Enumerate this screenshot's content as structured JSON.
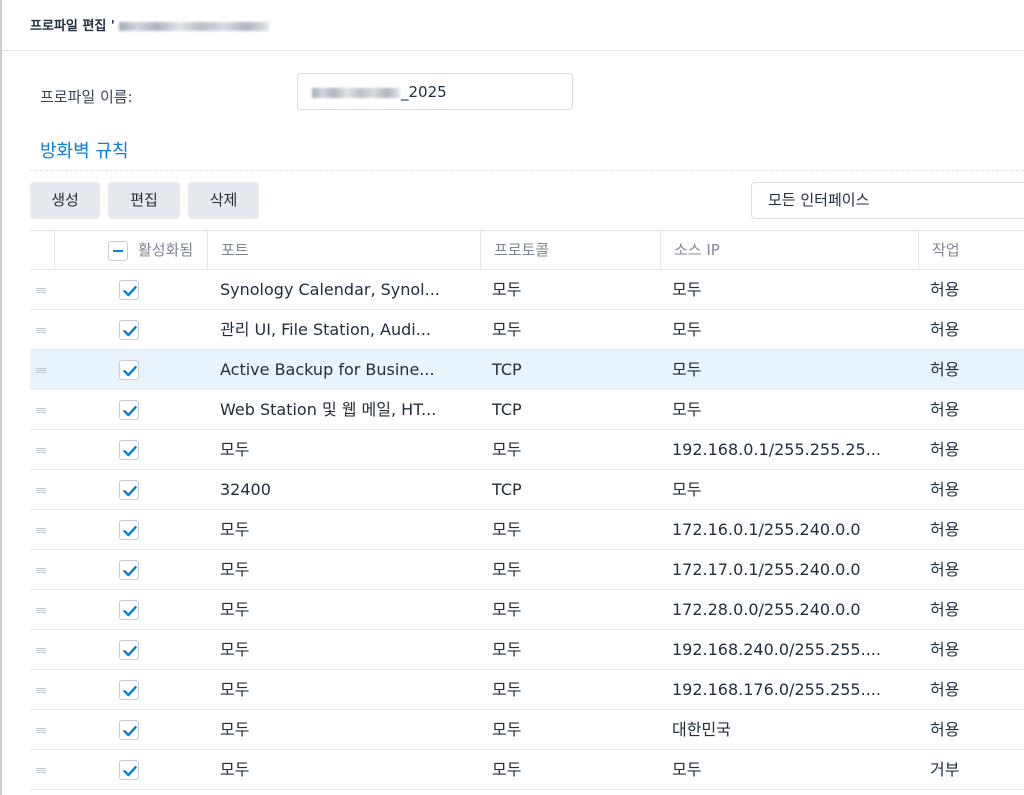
{
  "dialog": {
    "title": "프로파일 편집 '"
  },
  "profile": {
    "name_label": "프로파일 이름:",
    "name_value_suffix": "_2025"
  },
  "section": {
    "title": "방화벽 규칙"
  },
  "toolbar": {
    "create": "생성",
    "edit": "편집",
    "delete": "삭제",
    "interface_select": "모든 인터페이스"
  },
  "table": {
    "headers": {
      "enabled": "활성화됨",
      "ports": "포트",
      "protocol": "프로토콜",
      "source_ip": "소스 IP",
      "action": "작업"
    },
    "rows": [
      {
        "enabled": true,
        "ports": "Synology Calendar, Synol...",
        "protocol": "모두",
        "source_ip": "모두",
        "action": "허용"
      },
      {
        "enabled": true,
        "ports": "관리 UI, File Station, Audi...",
        "protocol": "모두",
        "source_ip": "모두",
        "action": "허용"
      },
      {
        "enabled": true,
        "ports": "Active Backup for Busine...",
        "protocol": "TCP",
        "source_ip": "모두",
        "action": "허용"
      },
      {
        "enabled": true,
        "ports": "Web Station 및 웹 메일, HT...",
        "protocol": "TCP",
        "source_ip": "모두",
        "action": "허용"
      },
      {
        "enabled": true,
        "ports": "모두",
        "protocol": "모두",
        "source_ip": "192.168.0.1/255.255.25...",
        "action": "허용"
      },
      {
        "enabled": true,
        "ports": "32400",
        "protocol": "TCP",
        "source_ip": "모두",
        "action": "허용"
      },
      {
        "enabled": true,
        "ports": "모두",
        "protocol": "모두",
        "source_ip": "172.16.0.1/255.240.0.0",
        "action": "허용"
      },
      {
        "enabled": true,
        "ports": "모두",
        "protocol": "모두",
        "source_ip": "172.17.0.1/255.240.0.0",
        "action": "허용"
      },
      {
        "enabled": true,
        "ports": "모두",
        "protocol": "모두",
        "source_ip": "172.28.0.0/255.240.0.0",
        "action": "허용"
      },
      {
        "enabled": true,
        "ports": "모두",
        "protocol": "모두",
        "source_ip": "192.168.240.0/255.255....",
        "action": "허용"
      },
      {
        "enabled": true,
        "ports": "모두",
        "protocol": "모두",
        "source_ip": "192.168.176.0/255.255....",
        "action": "허용"
      },
      {
        "enabled": true,
        "ports": "모두",
        "protocol": "모두",
        "source_ip": "대한민국",
        "action": "허용"
      },
      {
        "enabled": true,
        "ports": "모두",
        "protocol": "모두",
        "source_ip": "모두",
        "action": "거부"
      }
    ]
  },
  "colors": {
    "accent": "#0a7fd9",
    "selected_row": "#e8f3fc",
    "button_bg": "#e6eaef"
  }
}
